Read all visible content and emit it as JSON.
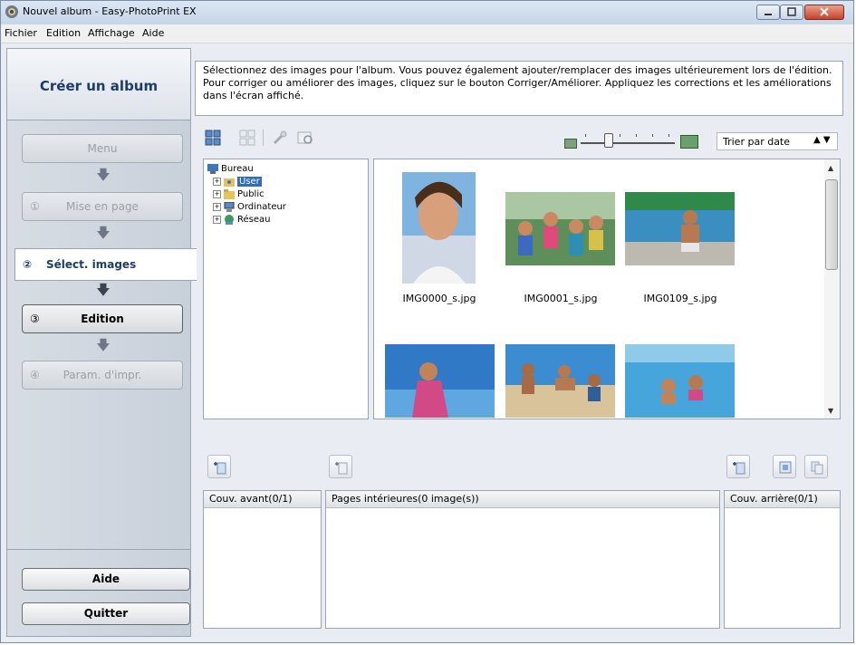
{
  "window": {
    "title": "Nouvel album - Easy-PhotoPrint EX"
  },
  "menu": [
    "Fichier",
    "Edition",
    "Affichage",
    "Aide"
  ],
  "left_panel": {
    "header": "Créer un album",
    "steps": [
      {
        "num": "",
        "label": "Menu",
        "state": "disabled"
      },
      {
        "num": "①",
        "label": "Mise en page",
        "state": "disabled"
      },
      {
        "num": "②",
        "label": "Sélect. images",
        "state": "active"
      },
      {
        "num": "③",
        "label": "Edition",
        "state": "enabled"
      },
      {
        "num": "④",
        "label": "Param. d'impr.",
        "state": "disabled"
      }
    ],
    "help_label": "Aide",
    "quit_label": "Quitter"
  },
  "instructions": "Sélectionnez des images pour l'album. Vous pouvez également ajouter/remplacer des images ultérieurement lors de l'édition. Pour corriger ou améliorer des images, cliquez sur le bouton Corriger/Améliorer. Appliquez les corrections et les améliorations dans l'écran affiché.",
  "toolbar": {
    "sort_value": "Trier par date",
    "icons": [
      "select-all-icon",
      "deselect-all-icon",
      "correct-enhance-icon",
      "preview-icon"
    ]
  },
  "tree": {
    "root": "Bureau",
    "items": [
      {
        "label": "User",
        "selected": true
      },
      {
        "label": "Public",
        "selected": false
      },
      {
        "label": "Ordinateur",
        "selected": false
      },
      {
        "label": "Réseau",
        "selected": false
      }
    ]
  },
  "gallery": {
    "images": [
      {
        "caption": "IMG0000_s.jpg"
      },
      {
        "caption": "IMG0001_s.jpg"
      },
      {
        "caption": "IMG0109_s.jpg"
      },
      {
        "caption": ""
      },
      {
        "caption": ""
      },
      {
        "caption": ""
      }
    ]
  },
  "bottom_panels": {
    "front": "Couv. avant(0/1)",
    "inner": "Pages intérieures(0 image(s))",
    "back": "Couv. arrière(0/1)"
  },
  "colors": {
    "accent": "#1c3d6b",
    "selection": "#316ac5"
  }
}
